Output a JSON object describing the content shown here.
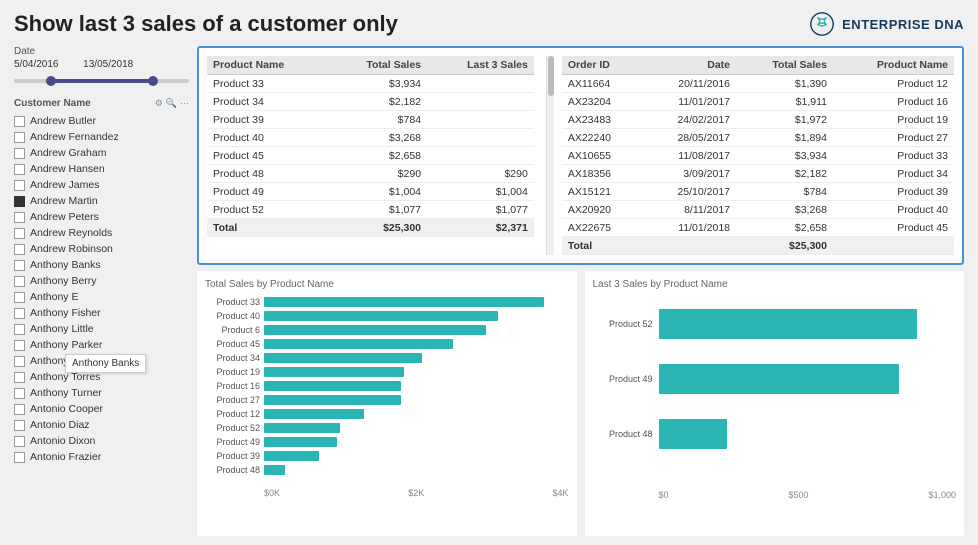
{
  "title": "Show last 3 sales of a customer only",
  "logo": {
    "text": "ENTERPRISE DNA",
    "icon": "dna-icon"
  },
  "date_section": {
    "label": "Date",
    "start": "5/04/2016",
    "end": "13/05/2018"
  },
  "customer_section": {
    "label": "Customer Name",
    "customers": [
      {
        "name": "Andrew Butler",
        "checked": false
      },
      {
        "name": "Andrew Fernandez",
        "checked": false
      },
      {
        "name": "Andrew Graham",
        "checked": false
      },
      {
        "name": "Andrew Hansen",
        "checked": false
      },
      {
        "name": "Andrew James",
        "checked": false
      },
      {
        "name": "Andrew Martin",
        "checked": true
      },
      {
        "name": "Andrew Peters",
        "checked": false
      },
      {
        "name": "Andrew Reynolds",
        "checked": false
      },
      {
        "name": "Andrew Robinson",
        "checked": false
      },
      {
        "name": "Anthony Banks",
        "checked": false
      },
      {
        "name": "Anthony Berry",
        "checked": false
      },
      {
        "name": "Anthony E",
        "checked": false
      },
      {
        "name": "Anthony Fisher",
        "checked": false
      },
      {
        "name": "Anthony Little",
        "checked": false
      },
      {
        "name": "Anthony Parker",
        "checked": false
      },
      {
        "name": "Anthony Simpson",
        "checked": false
      },
      {
        "name": "Anthony Torres",
        "checked": false
      },
      {
        "name": "Anthony Turner",
        "checked": false
      },
      {
        "name": "Antonio Cooper",
        "checked": false
      },
      {
        "name": "Antonio Diaz",
        "checked": false
      },
      {
        "name": "Antonio Dixon",
        "checked": false
      },
      {
        "name": "Antonio Frazier",
        "checked": false
      }
    ]
  },
  "tooltip": "Anthony Banks",
  "left_table": {
    "headers": [
      "Product Name",
      "Total Sales",
      "Last 3 Sales"
    ],
    "rows": [
      {
        "product": "Product 33",
        "total": "$3,934",
        "last3": ""
      },
      {
        "product": "Product 34",
        "total": "$2,182",
        "last3": ""
      },
      {
        "product": "Product 39",
        "total": "$784",
        "last3": ""
      },
      {
        "product": "Product 40",
        "total": "$3,268",
        "last3": ""
      },
      {
        "product": "Product 45",
        "total": "$2,658",
        "last3": ""
      },
      {
        "product": "Product 48",
        "total": "$290",
        "last3": "$290"
      },
      {
        "product": "Product 49",
        "total": "$1,004",
        "last3": "$1,004"
      },
      {
        "product": "Product 52",
        "total": "$1,077",
        "last3": "$1,077"
      }
    ],
    "total": {
      "product": "Total",
      "total": "$25,300",
      "last3": "$2,371"
    }
  },
  "right_table": {
    "headers": [
      "Order ID",
      "Date",
      "Total Sales",
      "Product Name"
    ],
    "rows": [
      {
        "order": "AX11664",
        "date": "20/11/2016",
        "total": "$1,390",
        "product": "Product 12"
      },
      {
        "order": "AX23204",
        "date": "11/01/2017",
        "total": "$1,911",
        "product": "Product 16"
      },
      {
        "order": "AX23483",
        "date": "24/02/2017",
        "total": "$1,972",
        "product": "Product 19"
      },
      {
        "order": "AX22240",
        "date": "28/05/2017",
        "total": "$1,894",
        "product": "Product 27"
      },
      {
        "order": "AX10655",
        "date": "11/08/2017",
        "total": "$3,934",
        "product": "Product 33"
      },
      {
        "order": "AX18356",
        "date": "3/09/2017",
        "total": "$2,182",
        "product": "Product 34"
      },
      {
        "order": "AX15121",
        "date": "25/10/2017",
        "total": "$784",
        "product": "Product 39"
      },
      {
        "order": "AX20920",
        "date": "8/11/2017",
        "total": "$3,268",
        "product": "Product 40"
      },
      {
        "order": "AX22675",
        "date": "11/01/2018",
        "total": "$2,658",
        "product": "Product 45"
      }
    ],
    "total": {
      "order": "Total",
      "date": "",
      "total": "$25,300",
      "product": ""
    }
  },
  "chart_left": {
    "title": "Total Sales by Product Name",
    "bars": [
      {
        "label": "Product 33",
        "value": 3934,
        "pct": 92
      },
      {
        "label": "Product 40",
        "value": 3268,
        "pct": 77
      },
      {
        "label": "Product 6",
        "value": 3100,
        "pct": 73
      },
      {
        "label": "Product 45",
        "value": 2658,
        "pct": 62
      },
      {
        "label": "Product 34",
        "value": 2182,
        "pct": 52
      },
      {
        "label": "Product 19",
        "value": 1972,
        "pct": 46
      },
      {
        "label": "Product 16",
        "value": 1911,
        "pct": 45
      },
      {
        "label": "Product 27",
        "value": 1894,
        "pct": 45
      },
      {
        "label": "Product 12",
        "value": 1390,
        "pct": 33
      },
      {
        "label": "Product 52",
        "value": 1077,
        "pct": 25
      },
      {
        "label": "Product 49",
        "value": 1004,
        "pct": 24
      },
      {
        "label": "Product 39",
        "value": 784,
        "pct": 18
      },
      {
        "label": "Product 48",
        "value": 290,
        "pct": 7
      }
    ],
    "axis": [
      "$0K",
      "$2K",
      "$4K"
    ]
  },
  "chart_right": {
    "title": "Last 3 Sales by Product Name",
    "bars": [
      {
        "label": "Product 52",
        "value": 1077,
        "pct": 87
      },
      {
        "label": "Product 49",
        "value": 1004,
        "pct": 81
      },
      {
        "label": "Product 48",
        "value": 290,
        "pct": 23
      }
    ],
    "axis": [
      "$0",
      "$500",
      "$1,000"
    ]
  }
}
